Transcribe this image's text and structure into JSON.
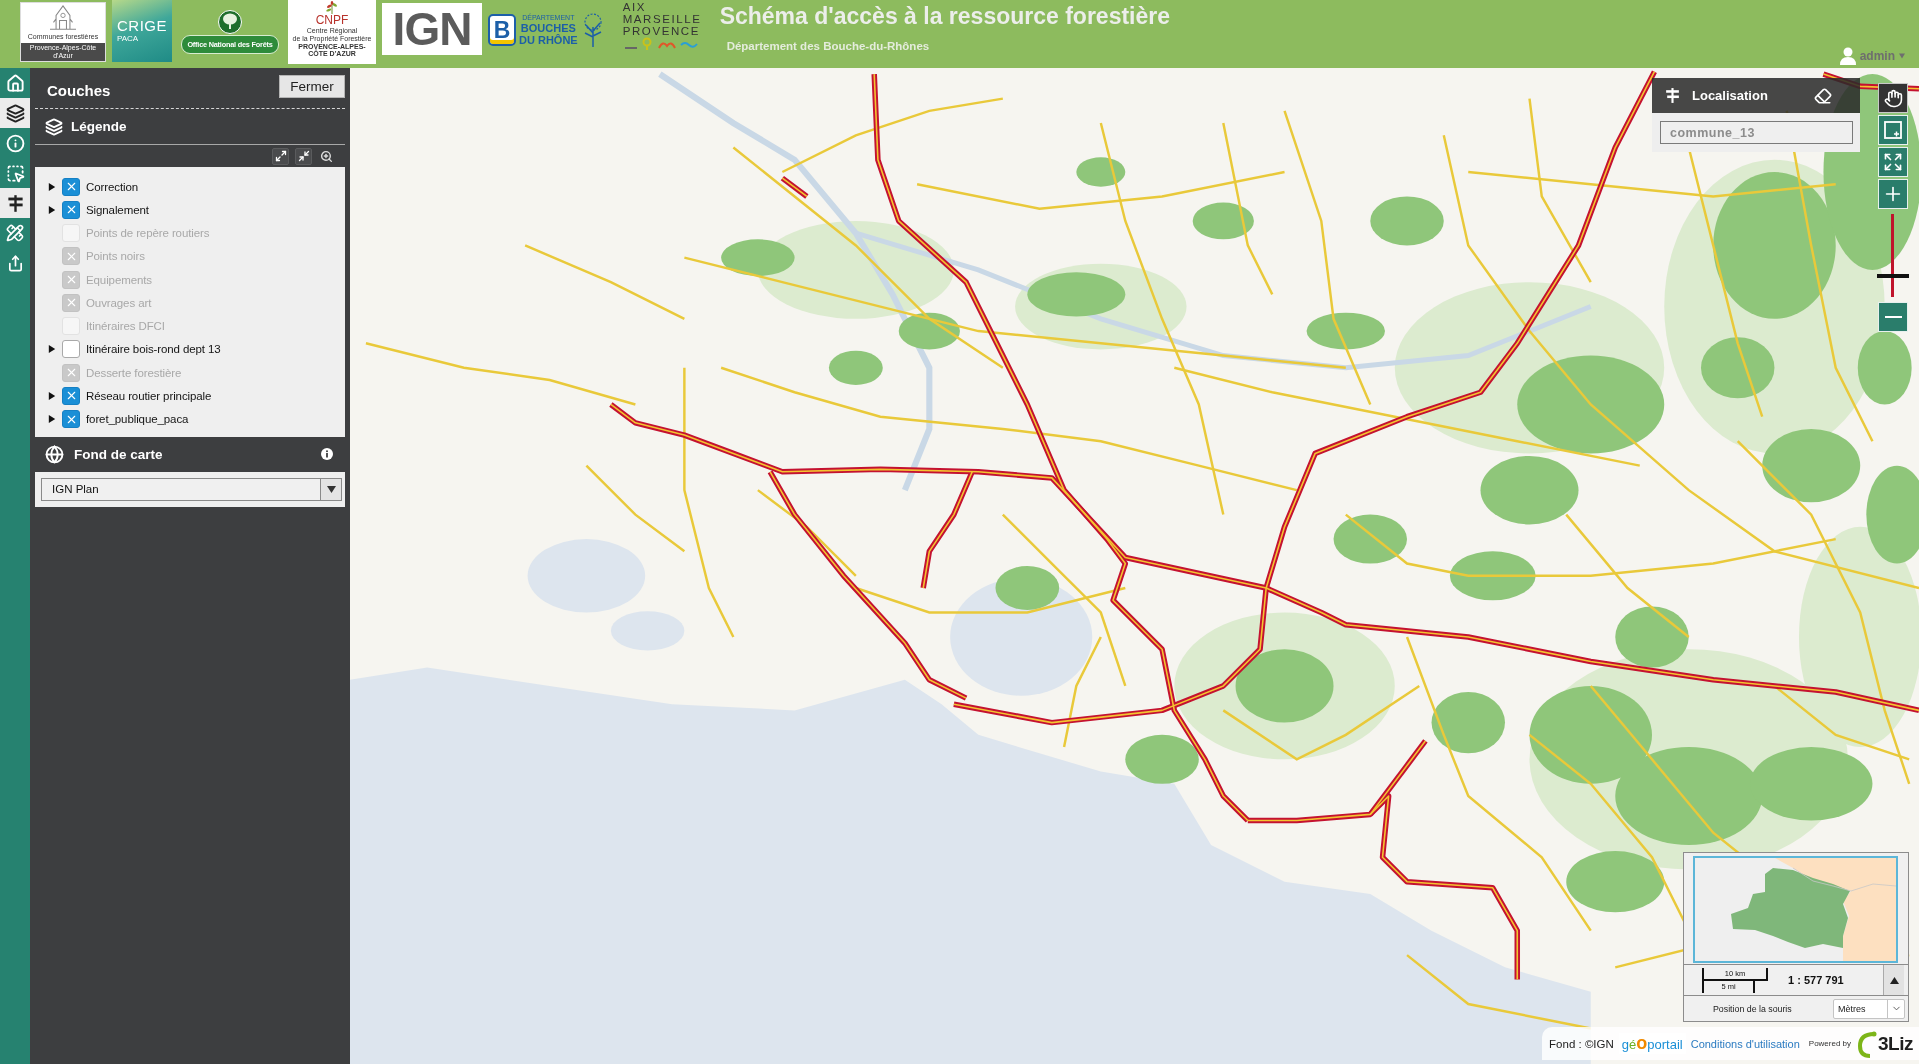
{
  "header": {
    "logos": [
      {
        "kind": "communes",
        "lines": [
          "Communes forestières",
          "Provence-Alpes-Côte d'Azur"
        ]
      },
      {
        "kind": "crige",
        "lines": [
          "CRIGE",
          "PACA"
        ]
      },
      {
        "kind": "onf",
        "lines": [
          "Office National des Forêts"
        ]
      },
      {
        "kind": "cnpf",
        "lines": [
          "CNPF",
          "Centre Régional",
          "de la Propriété Forestière",
          "PROVENCE-ALPES-CÔTE D'AZUR"
        ]
      },
      {
        "kind": "ign",
        "lines": [
          "IGN"
        ]
      },
      {
        "kind": "departement",
        "lines": [
          "B",
          "DÉPARTEMENT",
          "BOUCHES",
          "DU RHÔNE"
        ]
      },
      {
        "kind": "metropole",
        "lines": [
          "AIX",
          "MARSEILLE",
          "PROVENCE"
        ]
      }
    ],
    "title": "Schéma d'accès à la ressource forestière",
    "subtitle": "Département des Bouche-du-Rhônes",
    "user": "admin"
  },
  "sidebar": {
    "items": [
      {
        "kind": "home",
        "selected": false
      },
      {
        "kind": "layers",
        "selected": true
      },
      {
        "kind": "info",
        "selected": false
      },
      {
        "kind": "select",
        "selected": false
      },
      {
        "kind": "locate",
        "selected": true
      },
      {
        "kind": "measure",
        "selected": false
      },
      {
        "kind": "share",
        "selected": false
      }
    ]
  },
  "layers_panel": {
    "title": "Couches",
    "close_button": "Fermer",
    "legend_title": "Légende",
    "layers": [
      {
        "label": "Correction",
        "kind": "group",
        "checked": true,
        "disabled": false
      },
      {
        "label": "Signalement",
        "kind": "group",
        "checked": true,
        "disabled": false
      },
      {
        "label": "Points de repère routiers",
        "kind": "layer",
        "checked": false,
        "disabled": true
      },
      {
        "label": "Points noirs",
        "kind": "layer",
        "checked": true,
        "disabled": true
      },
      {
        "label": "Equipements",
        "kind": "layer",
        "checked": true,
        "disabled": true
      },
      {
        "label": "Ouvrages art",
        "kind": "layer",
        "checked": true,
        "disabled": true
      },
      {
        "label": "Itinéraires DFCI",
        "kind": "layer",
        "checked": false,
        "disabled": true
      },
      {
        "label": "Itinéraire bois-rond dept 13",
        "kind": "group",
        "checked": false,
        "disabled": false
      },
      {
        "label": "Desserte forestière",
        "kind": "layer",
        "checked": true,
        "disabled": true
      },
      {
        "label": "Réseau routier principale",
        "kind": "group",
        "checked": true,
        "disabled": false
      },
      {
        "label": "foret_publique_paca",
        "kind": "group",
        "checked": true,
        "disabled": false
      }
    ],
    "basemap": {
      "title": "Fond de carte",
      "value": "IGN Plan"
    }
  },
  "locate": {
    "title": "Localisation",
    "placeholder": "commune_13"
  },
  "map_nav": {
    "modes": [
      {
        "kind": "pan",
        "selected": true
      },
      {
        "kind": "zoom_box",
        "selected": false
      }
    ],
    "zoom": {
      "level": 0.25
    }
  },
  "overview": {
    "scale_km": "10 km",
    "scale_mi": "5 mi",
    "scale": "1 : 577 791",
    "mouse_position_label": "Position de la souris",
    "units": "Mètres"
  },
  "attribution": {
    "source": "Fond : ©IGN",
    "geoportail": [
      "g",
      "é",
      "o",
      "portail"
    ],
    "terms_link": "Conditions d'utilisation",
    "powered_by": "Powered by",
    "brand": "3Liz"
  }
}
